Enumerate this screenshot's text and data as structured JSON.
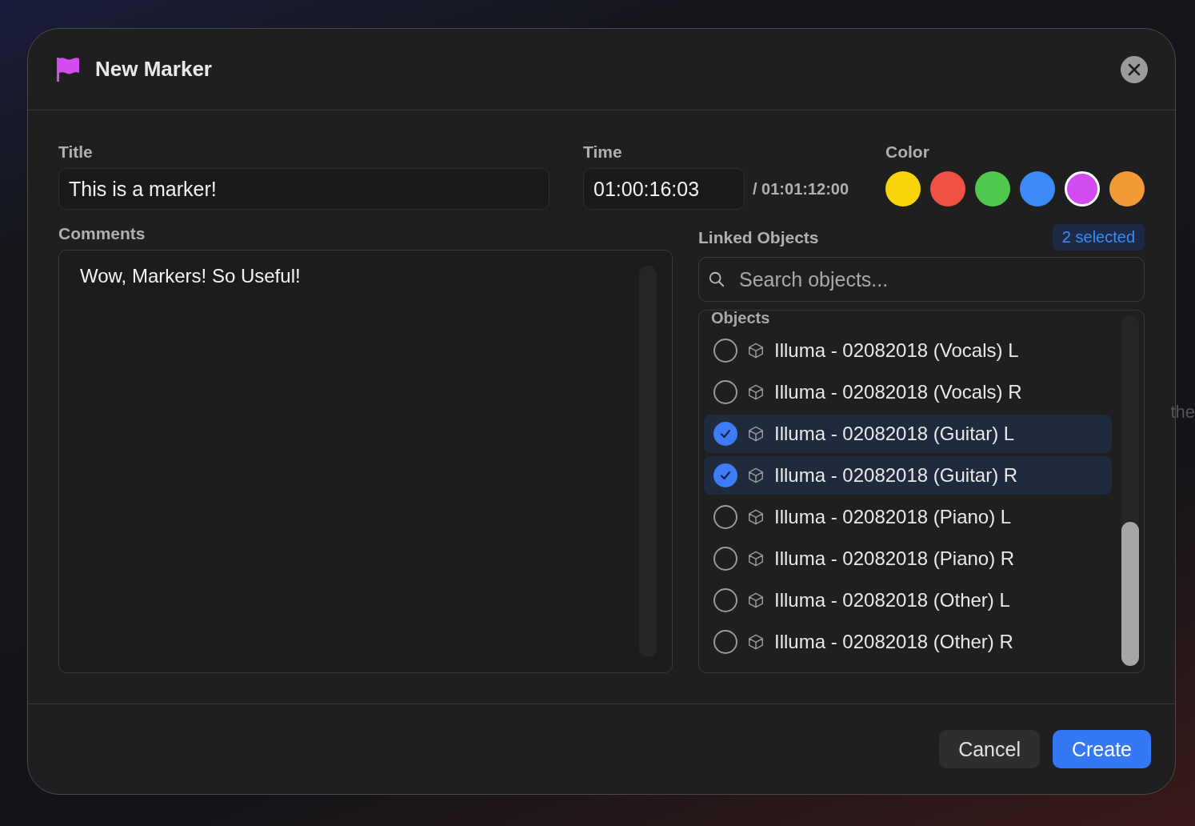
{
  "background": {
    "partial_text": "the"
  },
  "dialog": {
    "title": "New Marker"
  },
  "title_field": {
    "label": "Title",
    "value": "This is a marker!"
  },
  "time_field": {
    "label": "Time",
    "value": "01:00:16:03",
    "duration": "/ 01:01:12:00"
  },
  "color_picker": {
    "label": "Color",
    "swatches": [
      {
        "color": "#f7d50a",
        "selected": false
      },
      {
        "color": "#ef5245",
        "selected": false
      },
      {
        "color": "#4ec94e",
        "selected": false
      },
      {
        "color": "#3d8bf7",
        "selected": false
      },
      {
        "color": "#d24cf0",
        "selected": true
      },
      {
        "color": "#f29a38",
        "selected": false
      }
    ]
  },
  "comments": {
    "label": "Comments",
    "value": "Wow, Markers! So Useful!"
  },
  "linked_objects": {
    "label": "Linked Objects",
    "badge": "2 selected",
    "search": {
      "placeholder": "Search objects..."
    },
    "group": "Objects",
    "items": [
      {
        "name": "Illuma - 02082018 (Vocals) L",
        "checked": false
      },
      {
        "name": "Illuma - 02082018 (Vocals) R",
        "checked": false
      },
      {
        "name": "Illuma - 02082018 (Guitar) L",
        "checked": true
      },
      {
        "name": "Illuma - 02082018 (Guitar) R",
        "checked": true
      },
      {
        "name": "Illuma - 02082018 (Piano) L",
        "checked": false
      },
      {
        "name": "Illuma - 02082018 (Piano) R",
        "checked": false
      },
      {
        "name": "Illuma - 02082018 (Other) L",
        "checked": false
      },
      {
        "name": "Illuma - 02082018 (Other) R",
        "checked": false
      }
    ]
  },
  "buttons": {
    "cancel": "Cancel",
    "create": "Create"
  }
}
